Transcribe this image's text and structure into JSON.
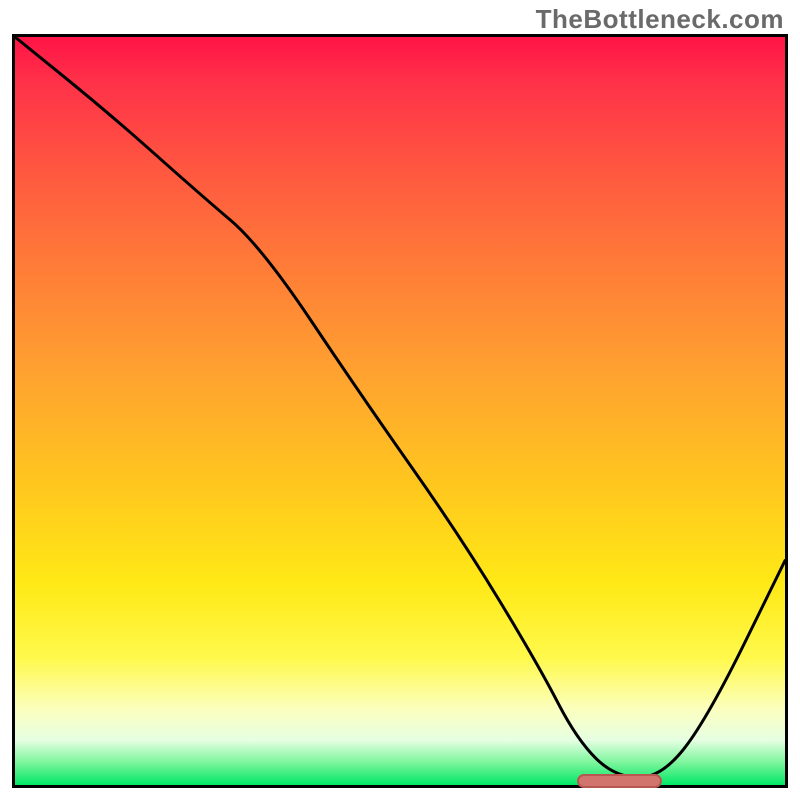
{
  "watermark": "TheBottleneck.com",
  "chart_data": {
    "type": "line",
    "title": "",
    "xlabel": "",
    "ylabel": "",
    "xlim": [
      0,
      100
    ],
    "ylim": [
      0,
      100
    ],
    "grid": false,
    "legend": false,
    "gradient_stops": [
      {
        "pct": 0,
        "color": "#ff1446"
      },
      {
        "pct": 6,
        "color": "#ff3149"
      },
      {
        "pct": 18,
        "color": "#ff5840"
      },
      {
        "pct": 30,
        "color": "#ff7a38"
      },
      {
        "pct": 45,
        "color": "#ffa230"
      },
      {
        "pct": 60,
        "color": "#ffc71e"
      },
      {
        "pct": 73,
        "color": "#ffe916"
      },
      {
        "pct": 83,
        "color": "#fff94c"
      },
      {
        "pct": 90,
        "color": "#fbffc0"
      },
      {
        "pct": 94,
        "color": "#e6ffe2"
      },
      {
        "pct": 97,
        "color": "#7cf59c"
      },
      {
        "pct": 100,
        "color": "#00e765"
      }
    ],
    "series": [
      {
        "name": "bottleneck-curve",
        "x": [
          0,
          12,
          24,
          32,
          45,
          58,
          68,
          73,
          78,
          84,
          90,
          100
        ],
        "y": [
          100,
          90,
          79,
          72,
          52,
          33,
          16,
          6,
          1,
          1,
          9,
          30
        ]
      }
    ],
    "marker": {
      "name": "optimal-range-marker",
      "x_start": 73,
      "x_end": 84,
      "y": 0.6,
      "color": "#d1746e"
    }
  }
}
